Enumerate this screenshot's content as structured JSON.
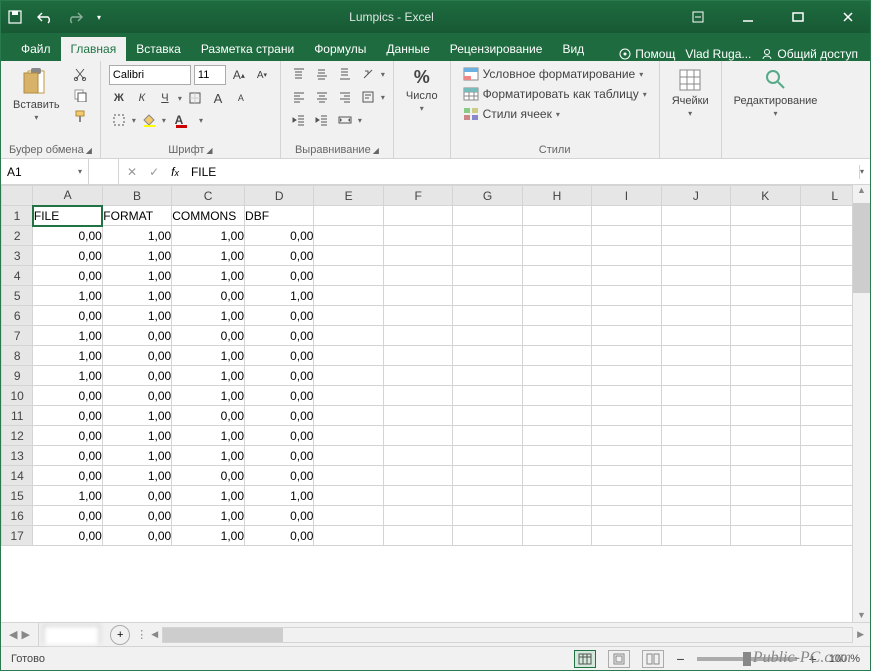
{
  "title": "Lumpics - Excel",
  "tabs": [
    "Файл",
    "Главная",
    "Вставка",
    "Разметка страни",
    "Формулы",
    "Данные",
    "Рецензирование",
    "Вид"
  ],
  "active_tab_index": 1,
  "help_label": "Помощ",
  "user_name": "Vlad Ruga...",
  "share_label": "Общий доступ",
  "ribbon": {
    "clipboard": {
      "paste": "Вставить",
      "label": "Буфер обмена"
    },
    "font": {
      "name": "Calibri",
      "size": "11",
      "label": "Шрифт",
      "bold": "Ж",
      "italic": "К",
      "underline": "Ч"
    },
    "alignment": {
      "label": "Выравнивание"
    },
    "number": {
      "btn": "%",
      "label": "Число"
    },
    "styles": {
      "cond": "Условное форматирование",
      "table": "Форматировать как таблицу",
      "cell": "Стили ячеек",
      "label": "Стили"
    },
    "cells": {
      "label": "Ячейки"
    },
    "editing": {
      "label": "Редактирование"
    }
  },
  "namebox": "A1",
  "formula_value": "FILE",
  "columns": [
    "A",
    "B",
    "C",
    "D",
    "E",
    "F",
    "G",
    "H",
    "I",
    "J",
    "K",
    "L"
  ],
  "headers": [
    "FILE",
    "FORMAT",
    "COMMONS",
    "DBF"
  ],
  "rows": [
    [
      "0,00",
      "1,00",
      "1,00",
      "0,00"
    ],
    [
      "0,00",
      "1,00",
      "1,00",
      "0,00"
    ],
    [
      "0,00",
      "1,00",
      "1,00",
      "0,00"
    ],
    [
      "1,00",
      "1,00",
      "0,00",
      "1,00"
    ],
    [
      "0,00",
      "1,00",
      "1,00",
      "0,00"
    ],
    [
      "1,00",
      "0,00",
      "0,00",
      "0,00"
    ],
    [
      "1,00",
      "0,00",
      "1,00",
      "0,00"
    ],
    [
      "1,00",
      "0,00",
      "1,00",
      "0,00"
    ],
    [
      "0,00",
      "0,00",
      "1,00",
      "0,00"
    ],
    [
      "0,00",
      "1,00",
      "0,00",
      "0,00"
    ],
    [
      "0,00",
      "1,00",
      "1,00",
      "0,00"
    ],
    [
      "0,00",
      "1,00",
      "1,00",
      "0,00"
    ],
    [
      "0,00",
      "1,00",
      "0,00",
      "0,00"
    ],
    [
      "1,00",
      "0,00",
      "1,00",
      "1,00"
    ],
    [
      "0,00",
      "0,00",
      "1,00",
      "0,00"
    ],
    [
      "0,00",
      "0,00",
      "1,00",
      "0,00"
    ]
  ],
  "status": "Готово",
  "zoom": "100 %",
  "watermark": "Public-PC.com"
}
